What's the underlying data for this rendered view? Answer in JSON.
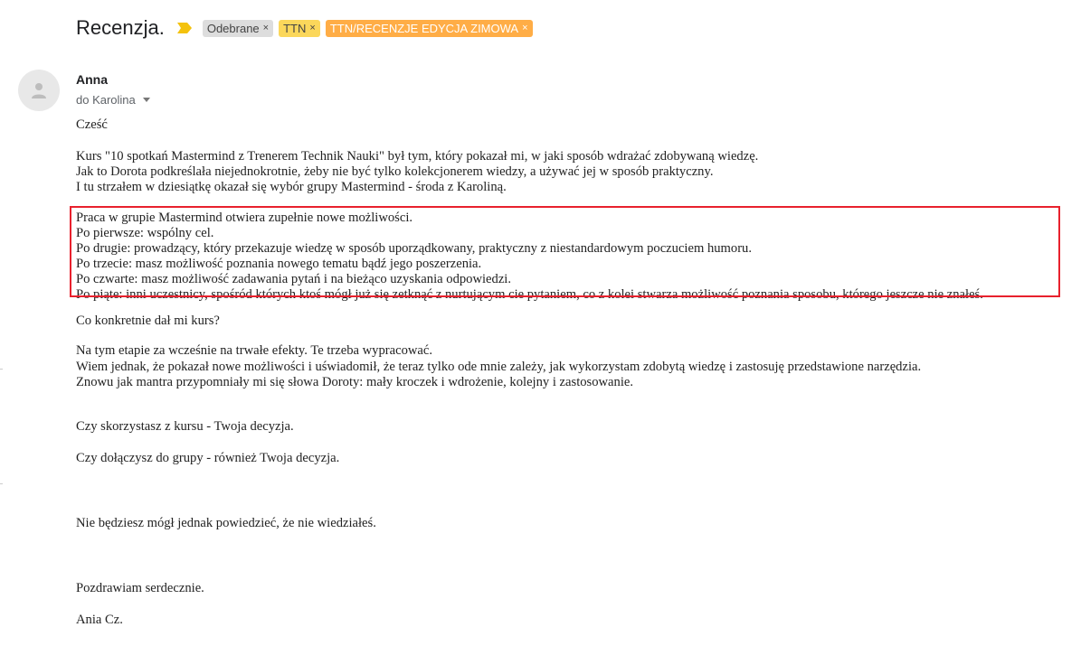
{
  "subject": "Recenzja.",
  "labels": [
    {
      "text": "Odebrane",
      "style": "gray"
    },
    {
      "text": "TTN",
      "style": "yellow"
    },
    {
      "text": "TTN/RECENZJE EDYCJA ZIMOWA",
      "style": "orange"
    }
  ],
  "label_remove_glyph": "×",
  "sender": "Anna",
  "recipient": "do Karolina",
  "colors": {
    "importance": "#f4c20d",
    "highlight_border": "#e8212d",
    "chip_orange": "#ffad46",
    "chip_yellow": "#fbd75b"
  },
  "icons": {
    "avatar": "person-icon",
    "importance": "importance-marker-icon",
    "caret": "chevron-down-icon"
  },
  "body": {
    "greeting": "Cześć",
    "intro": [
      "Kurs \"10 spotkań Mastermind z Trenerem Technik Nauki\" był tym, który pokazał mi, w jaki sposób wdrażać zdobywaną wiedzę.",
      "Jak to Dorota podkreślała niejednokrotnie, żeby nie być tylko kolekcjonerem wiedzy, a używać jej w sposób praktyczny.",
      "I tu strzałem w dziesiątkę okazał się wybór grupy Mastermind - środa z Karoliną."
    ],
    "highlight": [
      "Praca w grupie Mastermind otwiera zupełnie nowe możliwości.",
      "Po pierwsze: wspólny cel.",
      "Po drugie: prowadzący, który przekazuje wiedzę w sposób uporządkowany, praktyczny z niestandardowym poczuciem humoru.",
      "Po trzecie: masz możliwość poznania nowego tematu bądź jego poszerzenia.",
      "Po czwarte: masz możliwość zadawania pytań i na bieżąco uzyskania odpowiedzi.",
      "Po piąte: inni uczestnicy, spośród których ktoś mógł już się zetknąć z nurtującym cie pytaniem, co z kolei stwarza możliwość poznania sposobu, którego jeszcze nie znałeś."
    ],
    "question": "Co konkretnie dał mi kurs?",
    "effects": [
      "Na tym etapie za wcześnie na trwałe efekty. Te trzeba wypracować.",
      "Wiem jednak, że pokazał nowe możliwości i uświadomił, że teraz tylko ode mnie zależy, jak wykorzystam zdobytą wiedzę i zastosuję przedstawione narzędzia.",
      "Znowu jak mantra przypomniały mi się słowa Doroty: mały kroczek i wdrożenie, kolejny i zastosowanie."
    ],
    "decision1": "Czy skorzystasz z kursu - Twoja decyzja.",
    "decision2": "Czy dołączysz do grupy - również Twoja decyzja.",
    "closing": "Nie będziesz mógł jednak powiedzieć, że nie wiedziałeś.",
    "regards": "Pozdrawiam serdecznie.",
    "signature": "Ania Cz."
  }
}
